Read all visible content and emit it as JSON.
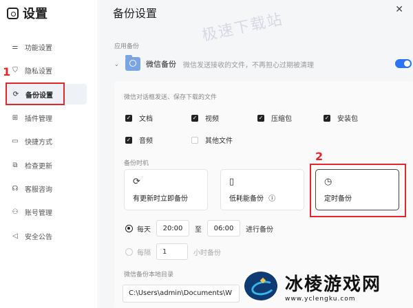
{
  "app": {
    "title": "设置"
  },
  "sidebar": {
    "items": [
      {
        "label": "功能设置",
        "icon": "sliders-icon"
      },
      {
        "label": "隐私设置",
        "icon": "shield-icon"
      },
      {
        "label": "备份设置",
        "icon": "sync-icon"
      },
      {
        "label": "插件管理",
        "icon": "grid-icon"
      },
      {
        "label": "快捷方式",
        "icon": "window-icon"
      },
      {
        "label": "检查更新",
        "icon": "update-icon"
      },
      {
        "label": "客服咨询",
        "icon": "headset-icon"
      },
      {
        "label": "账号管理",
        "icon": "user-icon"
      },
      {
        "label": "安全公告",
        "icon": "megaphone-icon"
      }
    ]
  },
  "annotations": {
    "num1": "1",
    "num2": "2",
    "highlight_color": "#e3252c"
  },
  "main": {
    "title": "备份设置",
    "watermark": "极速下载站",
    "app_backup_label": "应用备份",
    "wechat": {
      "name": "微信备份",
      "desc": "微信发送接收的文件，不再担心过期被清理",
      "enabled": true
    },
    "file_types_label": "微信对话框发送、保存下载的文件",
    "file_types": [
      {
        "label": "文档",
        "checked": true
      },
      {
        "label": "视频",
        "checked": true
      },
      {
        "label": "压缩包",
        "checked": true
      },
      {
        "label": "安装包",
        "checked": true
      },
      {
        "label": "音频",
        "checked": true
      },
      {
        "label": "其他文件",
        "checked": false
      }
    ],
    "backup_time_label": "备份时机",
    "modes": [
      {
        "label": "有更新时立即备份",
        "icon": "refresh-icon"
      },
      {
        "label": "低耗能备份",
        "icon": "battery-icon",
        "info": "ⓘ"
      },
      {
        "label": "定时备份",
        "icon": "clock-icon",
        "selected": true
      }
    ],
    "schedule": {
      "daily_label": "每天",
      "start": "20:00",
      "to": "至",
      "end": "06:00",
      "suffix": "进行备份",
      "interval_label": "每隔",
      "interval_value": "1",
      "interval_suffix": "小时备份"
    },
    "dir_label": "微信备份本地目录",
    "dir_value": "C:\\Users\\admin\\Documents\\W"
  },
  "logo": {
    "name": "冰棱游戏网",
    "url": "www.yclengku.com"
  },
  "colors": {
    "accent": "#2a74f5"
  }
}
